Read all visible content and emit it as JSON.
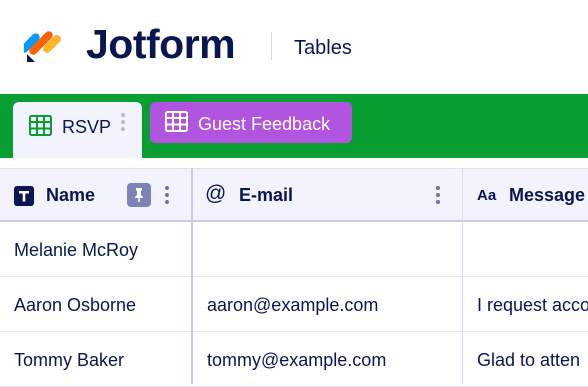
{
  "header": {
    "brand": "Jotform",
    "section": "Tables"
  },
  "tabs": [
    {
      "label": "RSVP",
      "active": true
    },
    {
      "label": "Guest Feedback",
      "active": false
    }
  ],
  "columns": [
    {
      "label": "Name",
      "icon": "text-type-icon"
    },
    {
      "label": "E-mail",
      "icon": "at-sign-icon"
    },
    {
      "label": "Message",
      "icon": "text-aa-icon"
    }
  ],
  "rows": [
    {
      "name": "Melanie McRoy",
      "email": "",
      "message": ""
    },
    {
      "name": "Aaron Osborne",
      "email": "aaron@example.com",
      "message": "I request acco"
    },
    {
      "name": "Tommy Baker",
      "email": "tommy@example.com",
      "message": "Glad to atten"
    }
  ],
  "colors": {
    "brand_navy": "#0a1551",
    "tabbar_green": "#099e32",
    "tab_purple": "#b155e0",
    "header_bg": "#f3f3fe"
  }
}
